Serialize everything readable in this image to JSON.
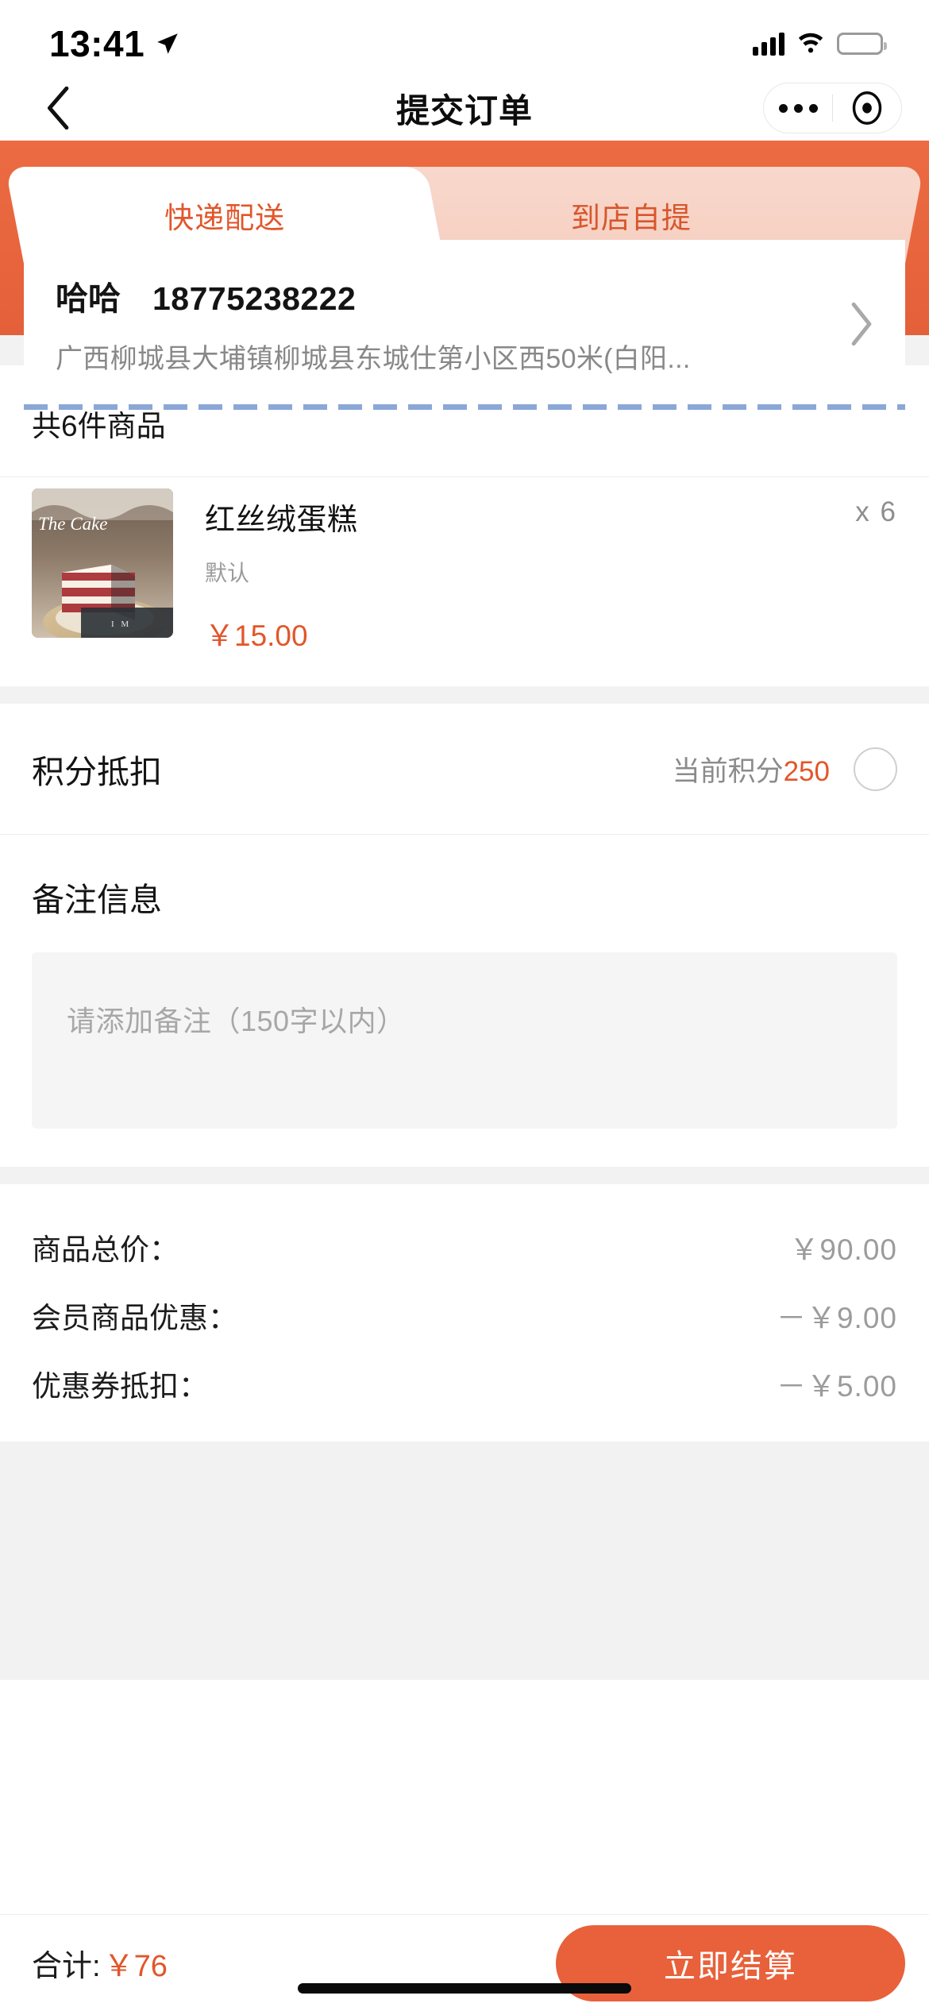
{
  "status_bar": {
    "time": "13:41",
    "location_icon": "location-arrow-icon",
    "signal_icon": "cellular-signal-icon",
    "wifi_icon": "wifi-icon",
    "battery_icon": "battery-low-power-icon"
  },
  "nav": {
    "back_icon": "chevron-left-icon",
    "title": "提交订单",
    "capsule_more_icon": "more-dots-icon",
    "capsule_target_icon": "target-circle-icon"
  },
  "tabs": [
    {
      "label": "快递配送",
      "active": true
    },
    {
      "label": "到店自提",
      "active": false
    }
  ],
  "address": {
    "name": "哈哈",
    "phone": "18775238222",
    "detail": "广西柳城县大埔镇柳城县东城仕第小区西50米(白阳...",
    "arrow_icon": "chevron-right-icon"
  },
  "goods": {
    "count_label": "共6件商品",
    "items": [
      {
        "name": "红丝绒蛋糕",
        "spec": "默认",
        "price": "￥15.00",
        "quantity": "x 6",
        "image_alt": "red-velvet-cake-photo",
        "image_caption": "The Cake"
      }
    ]
  },
  "points": {
    "label": "积分抵扣",
    "current_prefix": "当前积分",
    "current_value": "250",
    "checked": false
  },
  "remark": {
    "title": "备注信息",
    "placeholder": "请添加备注（150字以内）",
    "value": ""
  },
  "summary": {
    "rows": [
      {
        "label": "商品总价：",
        "value": "￥90.00"
      },
      {
        "label": "会员商品优惠：",
        "value": "－￥9.00"
      },
      {
        "label": "优惠券抵扣：",
        "value": "－￥5.00"
      }
    ]
  },
  "footer": {
    "total_label": "合计:",
    "total_value": "￥76",
    "checkout_label": "立即结算"
  },
  "colors": {
    "brand_orange": "#E8613B",
    "header_orange": "#E4603A",
    "price_orange": "#E2562A",
    "tab_inactive_bg": "#F6CFC1",
    "muted_text": "#9c9c9c",
    "battery_yellow": "#FBCE3C"
  }
}
